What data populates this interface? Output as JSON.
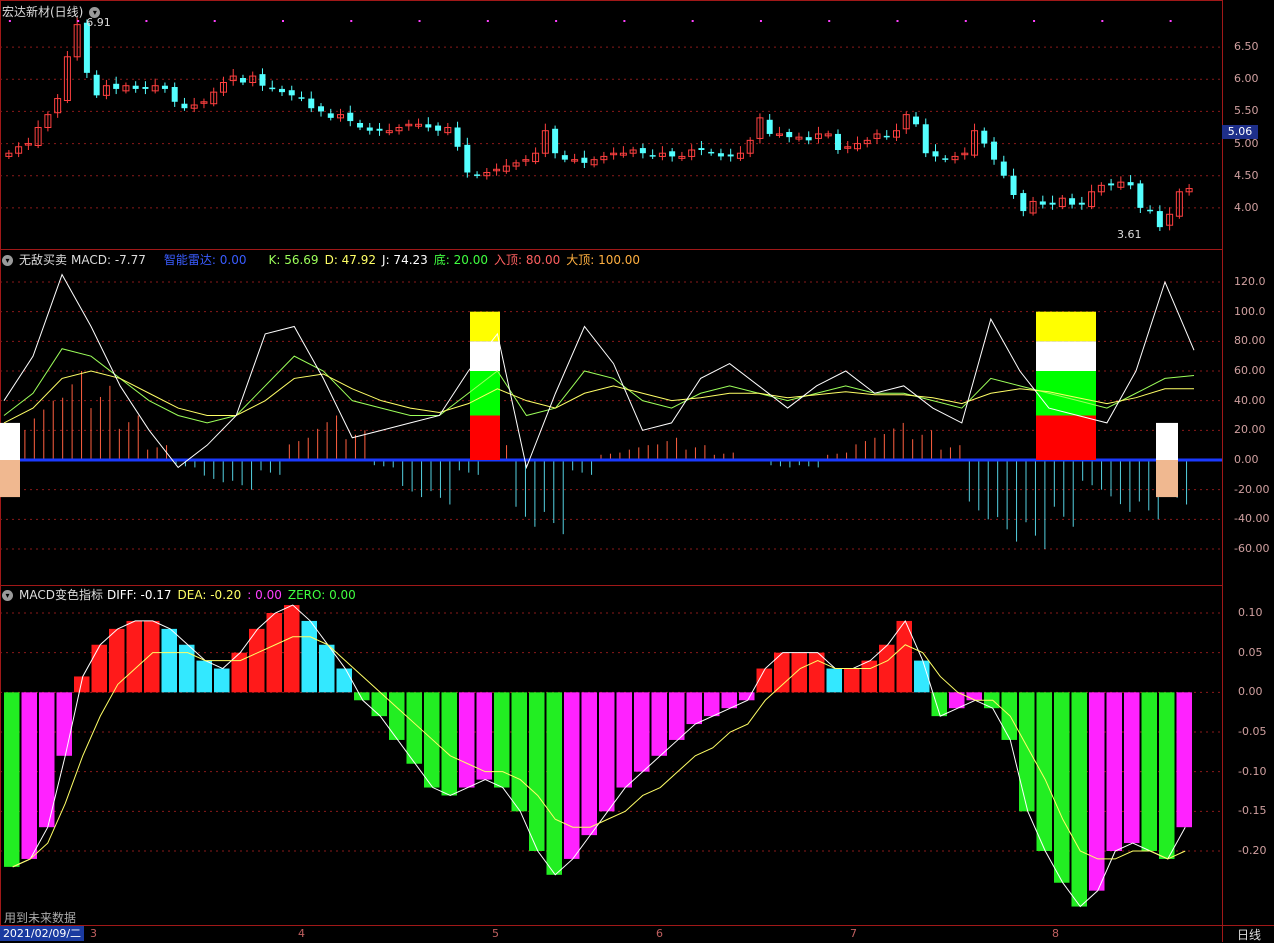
{
  "stock": {
    "title": "宏达新材(日线)"
  },
  "panels": {
    "main": {
      "label": "宏达新材(日线)",
      "high_label": "6.91",
      "low_label": "3.61",
      "last_price": "5.06"
    },
    "indicator1": {
      "name": "无敌买卖",
      "macd": "MACD: -7.77",
      "radar": "智能雷达: 0.00",
      "k": "K: 56.69",
      "d": "D: 47.92",
      "j": "J: 74.23",
      "bottom": "底: 20.00",
      "entry_top": "入顶: 80.00",
      "big_top": "大顶: 100.00"
    },
    "indicator2": {
      "name": "MACD变色指标",
      "diff": "DIFF: -0.17",
      "dea": "DEA: -0.20",
      "blank": ": 0.00",
      "zero": "ZERO: 0.00"
    }
  },
  "footer": {
    "date": "2021/02/09/二",
    "future_note": "用到未来数据",
    "period": "日线"
  },
  "colors": {
    "up": "#ff4040",
    "down": "#54ffff",
    "bg": "#000000",
    "grid": "#a01818"
  },
  "chart_data": [
    {
      "type": "candlestick",
      "title": "宏达新材(日线)",
      "y_ticks": [
        "6.50",
        "6.00",
        "5.50",
        "5.00",
        "4.50",
        "4.00"
      ],
      "ylim": [
        3.5,
        7.0
      ],
      "x_ticks": [
        "3",
        "4",
        "5",
        "6",
        "7",
        "8"
      ],
      "annotations": [
        "6.91",
        "3.61"
      ],
      "last_price": 5.06,
      "close": [
        4.85,
        4.95,
        5.0,
        5.25,
        5.45,
        5.7,
        6.35,
        6.85,
        6.1,
        5.75,
        5.9,
        5.85,
        5.9,
        5.85,
        5.85,
        5.9,
        5.85,
        5.65,
        5.55,
        5.6,
        5.65,
        5.8,
        5.95,
        6.05,
        5.95,
        6.05,
        5.9,
        5.85,
        5.8,
        5.75,
        5.7,
        5.55,
        5.5,
        5.4,
        5.45,
        5.35,
        5.25,
        5.2,
        5.2,
        5.2,
        5.25,
        5.3,
        5.3,
        5.25,
        5.2,
        5.25,
        4.95,
        4.55,
        4.5,
        4.55,
        4.6,
        4.65,
        4.7,
        4.75,
        4.85,
        5.2,
        4.85,
        4.75,
        4.75,
        4.7,
        4.75,
        4.8,
        4.85,
        4.85,
        4.9,
        4.85,
        4.8,
        4.85,
        4.8,
        4.8,
        4.9,
        4.9,
        4.85,
        4.8,
        4.8,
        4.85,
        5.05,
        5.4,
        5.15,
        5.15,
        5.1,
        5.1,
        5.05,
        5.15,
        5.15,
        4.9,
        4.95,
        5.0,
        5.05,
        5.15,
        5.1,
        5.2,
        5.45,
        5.3,
        4.85,
        4.8,
        4.75,
        4.8,
        4.85,
        5.2,
        5.0,
        4.75,
        4.5,
        4.2,
        3.95,
        4.1,
        4.05,
        4.05,
        4.15,
        4.05,
        4.05,
        4.25,
        4.35,
        4.35,
        4.4,
        4.35,
        4.0,
        3.95,
        3.7,
        3.9,
        4.25,
        4.3
      ]
    },
    {
      "type": "line",
      "title": "无敌买卖",
      "y_ticks": [
        "120.0",
        "100.0",
        "80.00",
        "60.00",
        "40.00",
        "20.00",
        "0.00",
        "-20.00",
        "-40.00",
        "-60.00"
      ],
      "ylim": [
        -80,
        130
      ],
      "series": [
        {
          "name": "K",
          "values": [
            30,
            45,
            75,
            70,
            55,
            40,
            30,
            25,
            30,
            50,
            70,
            60,
            40,
            35,
            30,
            30,
            45,
            60,
            30,
            35,
            60,
            55,
            40,
            35,
            45,
            50,
            45,
            40,
            45,
            50,
            45,
            45,
            40,
            35,
            55,
            50,
            45,
            40,
            35,
            45,
            55,
            57
          ]
        },
        {
          "name": "D",
          "values": [
            25,
            35,
            55,
            60,
            55,
            45,
            35,
            30,
            30,
            40,
            55,
            58,
            48,
            40,
            35,
            32,
            38,
            48,
            40,
            35,
            45,
            50,
            45,
            40,
            42,
            45,
            45,
            42,
            44,
            46,
            44,
            44,
            42,
            38,
            45,
            48,
            46,
            42,
            38,
            42,
            48,
            48
          ]
        },
        {
          "name": "J",
          "values": [
            40,
            70,
            125,
            90,
            50,
            20,
            -5,
            10,
            30,
            85,
            90,
            55,
            15,
            20,
            25,
            30,
            60,
            85,
            -5,
            45,
            90,
            65,
            20,
            25,
            55,
            65,
            50,
            35,
            50,
            60,
            45,
            50,
            35,
            25,
            95,
            60,
            35,
            30,
            25,
            60,
            120,
            74
          ]
        }
      ],
      "macd_hist": [
        20,
        40,
        60,
        50,
        30,
        10,
        -5,
        -15,
        -20,
        -10,
        15,
        30,
        20,
        -5,
        -25,
        -30,
        -10,
        10,
        -45,
        -50,
        -10,
        5,
        10,
        15,
        10,
        5,
        0,
        -5,
        -5,
        5,
        15,
        25,
        20,
        10,
        -40,
        -55,
        -60,
        -45,
        -20,
        -35,
        -40,
        -30
      ]
    },
    {
      "type": "bar",
      "title": "MACD变色指标",
      "y_ticks": [
        "0.10",
        "0.05",
        "0.00",
        "-0.05",
        "-0.10",
        "-0.15",
        "-0.20"
      ],
      "ylim": [
        -0.25,
        0.12
      ],
      "series": [
        {
          "name": "DIFF",
          "values": [
            -0.22,
            -0.21,
            -0.17,
            -0.08,
            0.02,
            0.06,
            0.08,
            0.09,
            0.09,
            0.08,
            0.06,
            0.04,
            0.03,
            0.05,
            0.08,
            0.1,
            0.11,
            0.09,
            0.06,
            0.03,
            -0.01,
            -0.03,
            -0.06,
            -0.09,
            -0.12,
            -0.13,
            -0.12,
            -0.11,
            -0.12,
            -0.15,
            -0.2,
            -0.23,
            -0.21,
            -0.18,
            -0.15,
            -0.12,
            -0.1,
            -0.08,
            -0.06,
            -0.04,
            -0.03,
            -0.02,
            -0.01,
            0.03,
            0.05,
            0.05,
            0.05,
            0.03,
            0.03,
            0.04,
            0.06,
            0.09,
            0.04,
            -0.03,
            -0.02,
            -0.01,
            -0.02,
            -0.06,
            -0.15,
            -0.2,
            -0.24,
            -0.27,
            -0.25,
            -0.2,
            -0.19,
            -0.2,
            -0.21,
            -0.17
          ]
        },
        {
          "name": "DEA",
          "values": [
            -0.22,
            -0.21,
            -0.19,
            -0.14,
            -0.08,
            -0.03,
            0.01,
            0.03,
            0.05,
            0.05,
            0.05,
            0.04,
            0.04,
            0.04,
            0.05,
            0.06,
            0.07,
            0.07,
            0.06,
            0.04,
            0.02,
            0.0,
            -0.02,
            -0.04,
            -0.06,
            -0.08,
            -0.09,
            -0.1,
            -0.1,
            -0.11,
            -0.13,
            -0.16,
            -0.17,
            -0.17,
            -0.16,
            -0.15,
            -0.13,
            -0.12,
            -0.1,
            -0.08,
            -0.07,
            -0.05,
            -0.04,
            -0.01,
            0.01,
            0.03,
            0.04,
            0.03,
            0.03,
            0.03,
            0.04,
            0.06,
            0.05,
            0.02,
            0.0,
            -0.01,
            -0.01,
            -0.03,
            -0.07,
            -0.11,
            -0.16,
            -0.2,
            -0.21,
            -0.21,
            -0.2,
            -0.2,
            -0.21,
            -0.2
          ]
        }
      ]
    }
  ]
}
